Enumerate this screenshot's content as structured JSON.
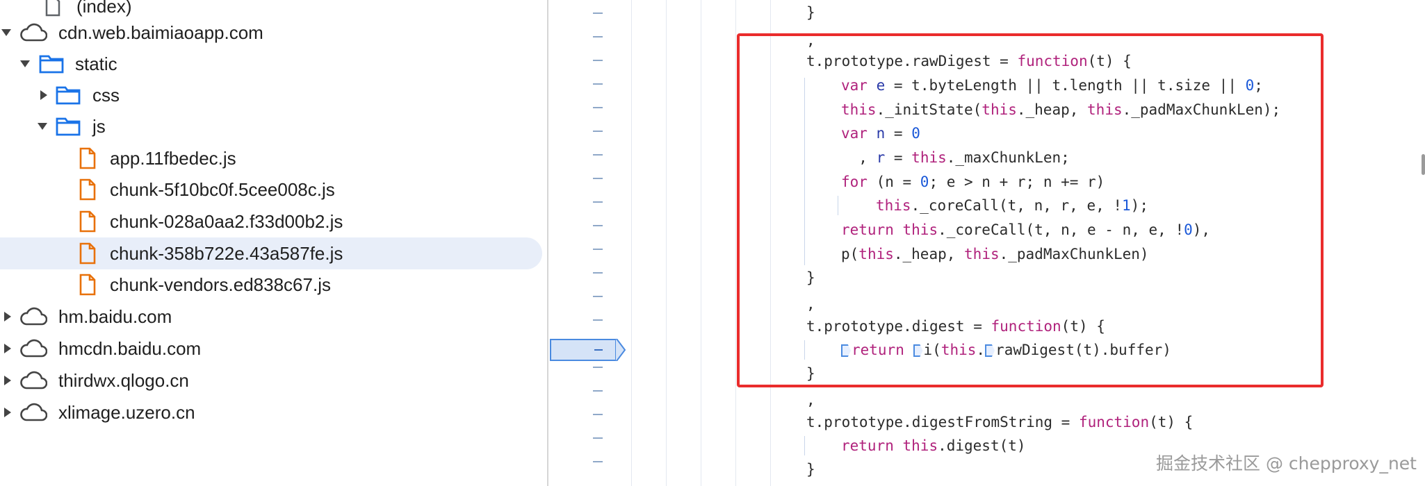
{
  "file_tree": {
    "items": [
      {
        "label": "(index)",
        "icon": "file-icon"
      },
      {
        "label": "cdn.web.baimiaoapp.com",
        "icon": "cloud-icon",
        "expanded": true
      },
      {
        "label": "static",
        "icon": "folder-icon",
        "expanded": true
      },
      {
        "label": "css",
        "icon": "folder-icon",
        "expanded": false
      },
      {
        "label": "js",
        "icon": "folder-icon",
        "expanded": true
      },
      {
        "label": "app.11fbedec.js",
        "icon": "js-file-icon"
      },
      {
        "label": "chunk-5f10bc0f.5cee008c.js",
        "icon": "js-file-icon"
      },
      {
        "label": "chunk-028a0aa2.f33d00b2.js",
        "icon": "js-file-icon"
      },
      {
        "label": "chunk-358b722e.43a587fe.js",
        "icon": "js-file-icon",
        "selected": true
      },
      {
        "label": "chunk-vendors.ed838c67.js",
        "icon": "js-file-icon"
      },
      {
        "label": "hm.baidu.com",
        "icon": "cloud-icon",
        "expanded": false
      },
      {
        "label": "hmcdn.baidu.com",
        "icon": "cloud-icon",
        "expanded": false
      },
      {
        "label": "thirdwx.qlogo.cn",
        "icon": "cloud-icon",
        "expanded": false
      },
      {
        "label": "xlimage.uzero.cn",
        "icon": "cloud-icon",
        "expanded": false
      }
    ]
  },
  "gutter": {
    "marker": "–",
    "breakpoint_line": 14
  },
  "code": {
    "lines": [
      "}",
      ",",
      "t.prototype.rawDigest = function(t) {",
      "var e = t.byteLength || t.length || t.size || 0;",
      "this._initState(this._heap, this._padMaxChunkLen);",
      "var n = 0",
      "  , r = this._maxChunkLen;",
      "for (n = 0; e > n + r; n += r)",
      "this._coreCall(t, n, r, e, !1);",
      "return this._coreCall(t, n, e - n, e, !0),",
      "p(this._heap, this._padMaxChunkLen)",
      "}",
      ",",
      "t.prototype.digest = function(t) {",
      "return i(this.rawDigest(t).buffer)",
      "}",
      ",",
      "t.prototype.digestFromString = function(t) {",
      "return this.digest(t)",
      "}"
    ]
  },
  "watermark": "掘金技术社区 @ chepproxy_net",
  "colors": {
    "keyword": "#b0227c",
    "number": "#1a58d8",
    "highlight_box": "#ea2c2c",
    "selected_row": "#e8eef9",
    "folder": "#1a73e8",
    "js_file": "#e8710a"
  }
}
